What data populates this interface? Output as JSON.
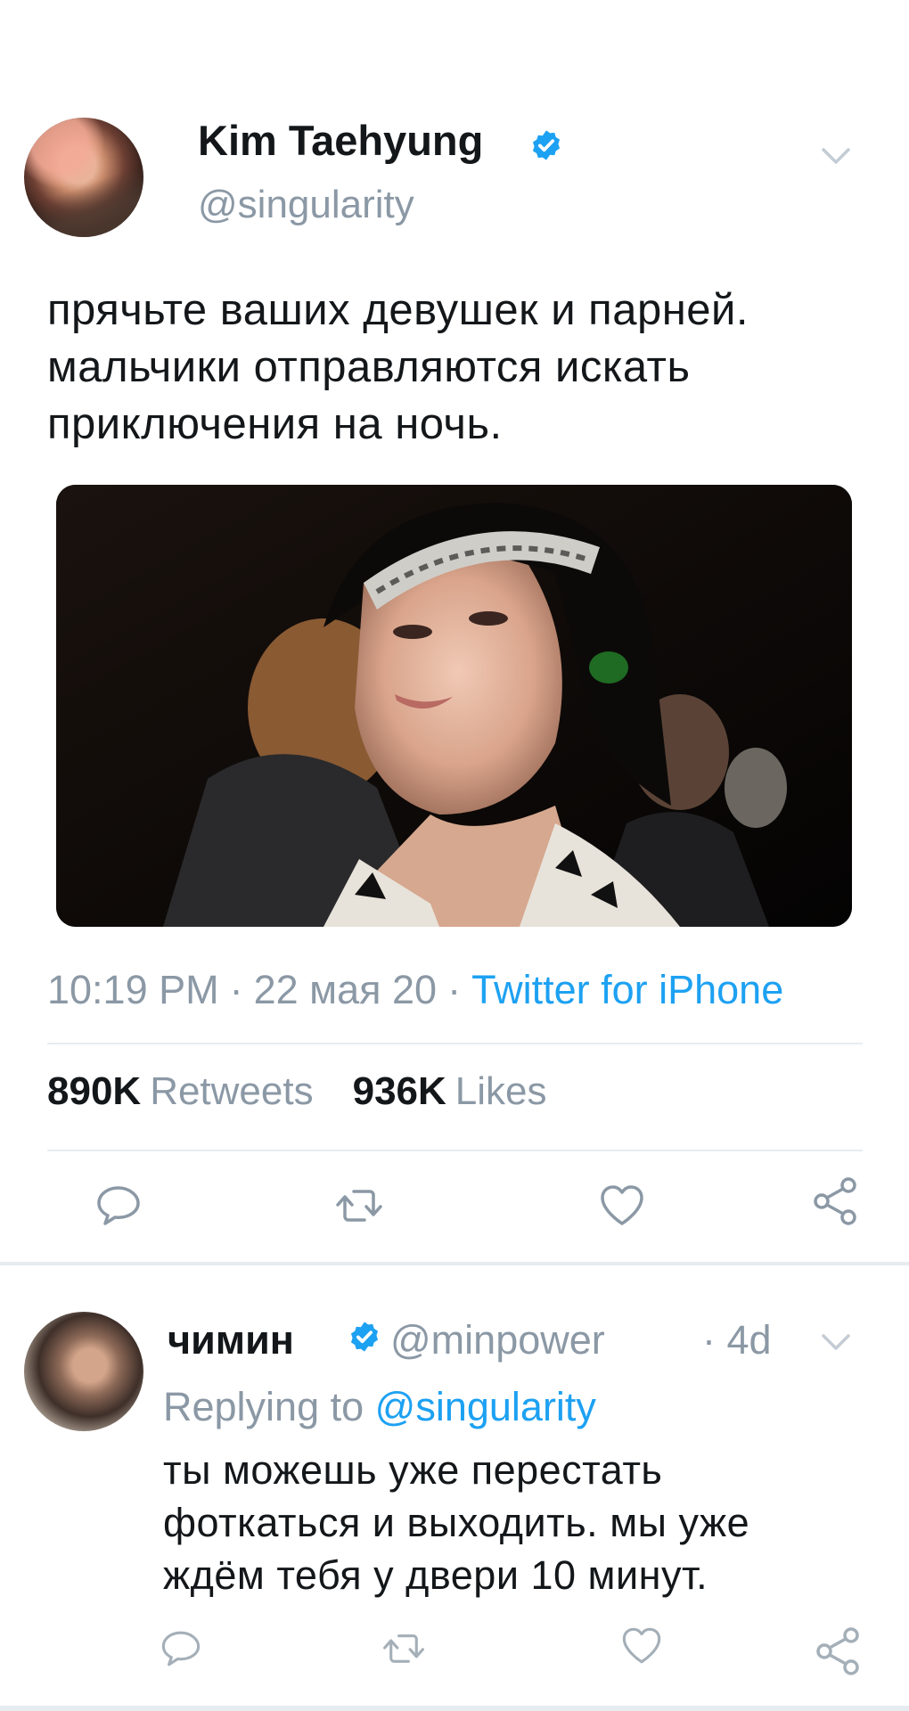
{
  "tweet": {
    "author_name": "Kim Taehyung",
    "author_handle": "@singularity",
    "text_lines": [
      "прячьте ваших девушек и парней.",
      "мальчики отправляются искать",
      "приключения на ночь."
    ],
    "time": "10:19 PM",
    "date": "22 мая 20",
    "source": "Twitter for iPhone",
    "retweets_count": "890K",
    "retweets_label": "Retweets",
    "likes_count": "936K",
    "likes_label": "Likes",
    "media_icon": "photo-portrait"
  },
  "reply": {
    "author_name": "чимин",
    "author_handle": "@minpower",
    "time": "· 4d",
    "replying_prefix": "Replying to",
    "replying_to": "@singularity",
    "text_lines": [
      "ты можешь уже перестать",
      "фоткаться и выходить. мы уже",
      "ждём тебя у двери 10 минут."
    ]
  },
  "colors": {
    "accent": "#1da1f2",
    "secondary_text": "#8b98a5",
    "primary_text": "#14171a",
    "divider": "#e6ecf0"
  },
  "icons": {
    "verified": "verified-badge-icon",
    "reply": "reply-icon",
    "retweet": "retweet-icon",
    "like": "heart-icon",
    "share": "share-icon",
    "more": "chevron-down-icon"
  }
}
